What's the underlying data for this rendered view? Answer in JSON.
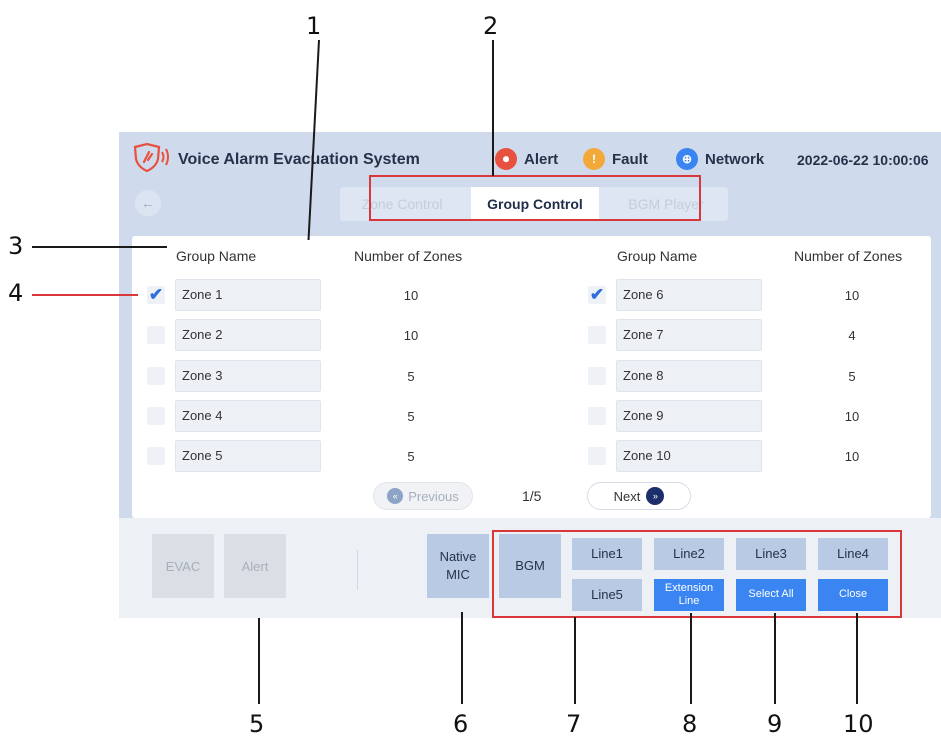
{
  "app": {
    "title": "Voice Alarm Evacuation System",
    "datetime": "2022-06-22  10:00:06"
  },
  "status": [
    {
      "label": "Alert",
      "icon": "alarm-icon",
      "color": "#e8503f"
    },
    {
      "label": "Fault",
      "icon": "warning-icon",
      "color": "#f3a93a"
    },
    {
      "label": "Network",
      "icon": "globe-icon",
      "color": "#3a85f2"
    }
  ],
  "tabs": [
    "Zone Control",
    "Group Control",
    "BGM Player"
  ],
  "active_tab": "Group Control",
  "table": {
    "col_group": "Group Name",
    "col_zones": "Number of Zones",
    "left": [
      {
        "name": "Zone 1",
        "zones": "10",
        "checked": true
      },
      {
        "name": "Zone 2",
        "zones": "10",
        "checked": false
      },
      {
        "name": "Zone 3",
        "zones": "5",
        "checked": false
      },
      {
        "name": "Zone 4",
        "zones": "5",
        "checked": false
      },
      {
        "name": "Zone 5",
        "zones": "5",
        "checked": false
      }
    ],
    "right": [
      {
        "name": "Zone 6",
        "zones": "10",
        "checked": true
      },
      {
        "name": "Zone 7",
        "zones": "4",
        "checked": false
      },
      {
        "name": "Zone 8",
        "zones": "5",
        "checked": false
      },
      {
        "name": "Zone 9",
        "zones": "10",
        "checked": false
      },
      {
        "name": "Zone 10",
        "zones": "10",
        "checked": false
      }
    ]
  },
  "pagination": {
    "prev": "Previous",
    "page": "1/5",
    "next": "Next"
  },
  "bottom": {
    "evac": "EVAC",
    "alert": "Alert",
    "native_mic": "Native MIC",
    "bgm": "BGM",
    "lines": [
      "Line1",
      "Line2",
      "Line3",
      "Line4",
      "Line5"
    ],
    "extension_line": "Extension Line",
    "select_all": "Select All",
    "close": "Close"
  },
  "callouts": [
    "1",
    "2",
    "3",
    "4",
    "5",
    "6",
    "7",
    "8",
    "9",
    "10"
  ],
  "colors": {
    "accent": "#3a85f2",
    "annotation": "#d9383a",
    "check": "#2d6fdc"
  }
}
